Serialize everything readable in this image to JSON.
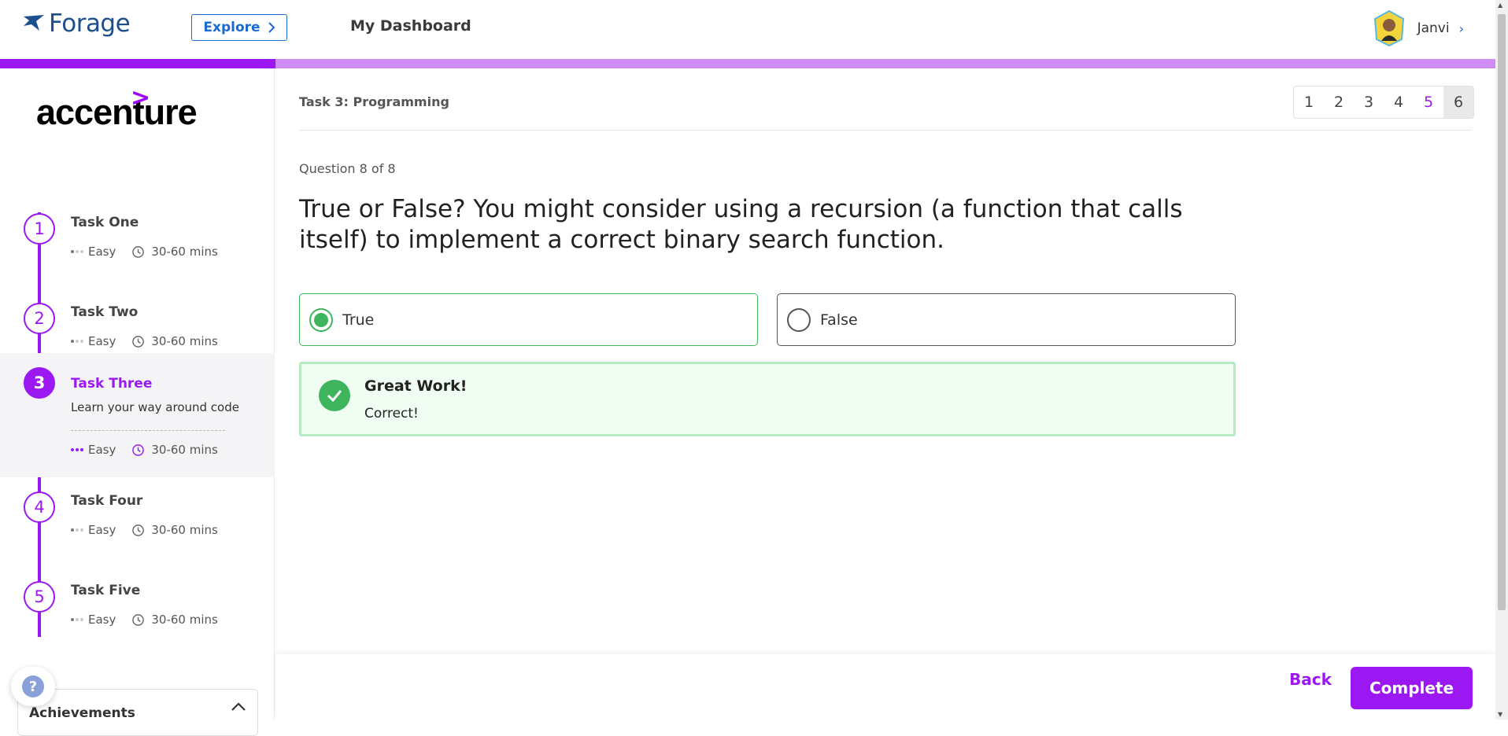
{
  "nav": {
    "logo_text": "Forage",
    "explore_label": "Explore",
    "dashboard_label": "My Dashboard",
    "user_name": "Janvi"
  },
  "sidebar": {
    "company_logo": "accenture",
    "tasks": [
      {
        "num": "1",
        "title": "Task One",
        "difficulty": "Easy",
        "duration": "30-60 mins"
      },
      {
        "num": "2",
        "title": "Task Two",
        "difficulty": "Easy",
        "duration": "30-60 mins"
      },
      {
        "num": "3",
        "title": "Task Three",
        "description": "Learn your way around code",
        "difficulty": "Easy",
        "duration": "30-60 mins",
        "active": true
      },
      {
        "num": "4",
        "title": "Task Four",
        "difficulty": "Easy",
        "duration": "30-60 mins"
      },
      {
        "num": "5",
        "title": "Task Five",
        "difficulty": "Easy",
        "duration": "30-60 mins"
      }
    ],
    "help_icon": "?",
    "achievements_label": "Achievements"
  },
  "main": {
    "task_header": "Task 3: Programming",
    "pager": [
      "1",
      "2",
      "3",
      "4",
      "5",
      "6"
    ],
    "question_count": "Question 8 of 8",
    "question_text": "True or False? You might consider using a recursion (a function that calls itself) to implement a correct binary search function.",
    "options": [
      "True",
      "False"
    ],
    "selected_option": "True",
    "feedback_title": "Great Work!",
    "feedback_body": "Correct!"
  },
  "footer": {
    "back_label": "Back",
    "complete_label": "Complete"
  },
  "colors": {
    "brand_purple": "#9b18f2",
    "success_green": "#3eb55c",
    "forage_blue": "#1c4f8e"
  }
}
